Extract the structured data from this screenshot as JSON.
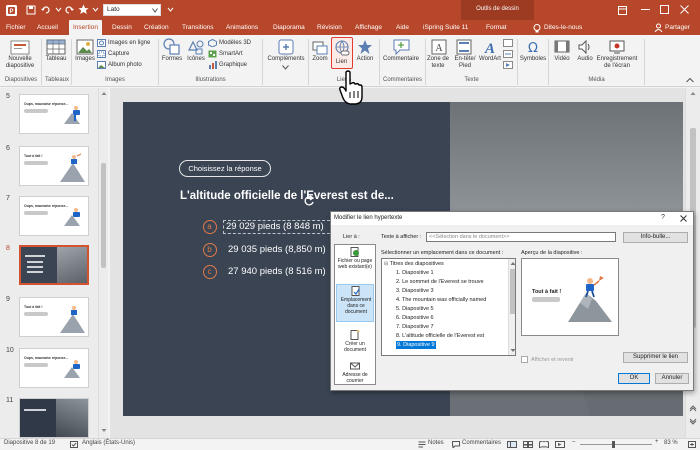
{
  "qat": {
    "font_name": "Lato"
  },
  "window": {
    "context_title": "Outils de dessin"
  },
  "tabs": {
    "file": "Fichier",
    "home": "Accueil",
    "insert": "Insertion",
    "design": "Dessin",
    "create": "Création",
    "transitions": "Transitions",
    "animations": "Animations",
    "slideshow": "Diaporama",
    "review": "Révision",
    "view": "Affichage",
    "help": "Aide",
    "ispring": "iSpring Suite 11",
    "format": "Format",
    "tell": "Dites-le-nous",
    "share": "Partager"
  },
  "ribbon": {
    "new_slide": "Nouvelle diapositive",
    "table": "Tableau",
    "images": "Images",
    "online_images": "Images en ligne",
    "capture": "Capture",
    "album": "Album photo",
    "shapes": "Formes",
    "icons": "Icônes",
    "models3d": "Modèles 3D",
    "smartart": "SmartArt",
    "graphic": "Graphique",
    "addins": "Compléments",
    "zoom": "Zoom",
    "link": "Lien",
    "action": "Action",
    "comment": "Commentaire",
    "textbox": "Zone de texte",
    "header": "En-tête/ Pied",
    "wordart": "WordArt",
    "symbols": "Symboles",
    "video": "Vidéo",
    "audio": "Audio",
    "screen_rec": "Enregistrement de l'écran",
    "groups": {
      "slides": "Diapositives",
      "tables": "Tableaux",
      "images": "Images",
      "illustrations": "Illustrations",
      "links": "Liens",
      "comments": "Commentaires",
      "text": "Texte",
      "media": "Média"
    }
  },
  "thumbnails": [
    {
      "num": "5",
      "title": "Oups, mauvaise réponse...",
      "dark": false
    },
    {
      "num": "6",
      "title": "Tout à fait !",
      "dark": false
    },
    {
      "num": "7",
      "title": "Oups, mauvaise réponse...",
      "dark": false
    },
    {
      "num": "8",
      "title": "",
      "dark": true
    },
    {
      "num": "9",
      "title": "Tout à fait !",
      "dark": false
    },
    {
      "num": "10",
      "title": "Oups, mauvaise réponse...",
      "dark": false
    },
    {
      "num": "11",
      "title": "",
      "dark": true
    }
  ],
  "slide": {
    "pill": "Choisissez la réponse",
    "question": "L'altitude officielle de l'Everest est de...",
    "options": [
      {
        "letter": "a",
        "text": "29 029 pieds (8 848 m)"
      },
      {
        "letter": "b",
        "text": "29 035 pieds (8,850 m)"
      },
      {
        "letter": "c",
        "text": "27 940 pieds (8 516 m)"
      }
    ]
  },
  "dialog": {
    "title": "Modifier le lien hypertexte",
    "help": "?",
    "link_to": "Lier à :",
    "text_label": "Texte à afficher :",
    "text_value": "<<Sélection dans le document>>",
    "info_button": "Info-bulle...",
    "left_items": [
      "Fichier ou page web existant(e)",
      "Emplacement dans ce document",
      "Créer un document",
      "Adresse de courrier"
    ],
    "place_label": "Sélectionner un emplacement dans ce document :",
    "tree_root": "Titres des diapositives",
    "tree_items": [
      "1. Diapositive 1",
      "2. Le sommet de l'Everest se trouve",
      "3. Diapositive 3",
      "4. The mountain was officially named",
      "5. Diapositive 5",
      "6. Diapositive 6",
      "7. Diapositive 7",
      "8. L'altitude officielle de l'Everest est",
      "9. Diapositive 9"
    ],
    "preview_label": "Aperçu de la diapositive :",
    "preview_title": "Tout à fait !",
    "show_return": "Afficher et revenir",
    "remove_link": "Supprimer le lien",
    "ok": "OK",
    "cancel": "Annuler"
  },
  "status": {
    "slide_info": "Diapositive 8 de 19",
    "language": "Anglais (États-Unis)",
    "notes": "Notes",
    "comments": "Commentaires",
    "zoom": "83 %"
  },
  "colors": {
    "accent": "#b7472a",
    "slide_bg": "#3a4453",
    "option_ring": "#e07a4a",
    "selection": "#0078d7"
  }
}
